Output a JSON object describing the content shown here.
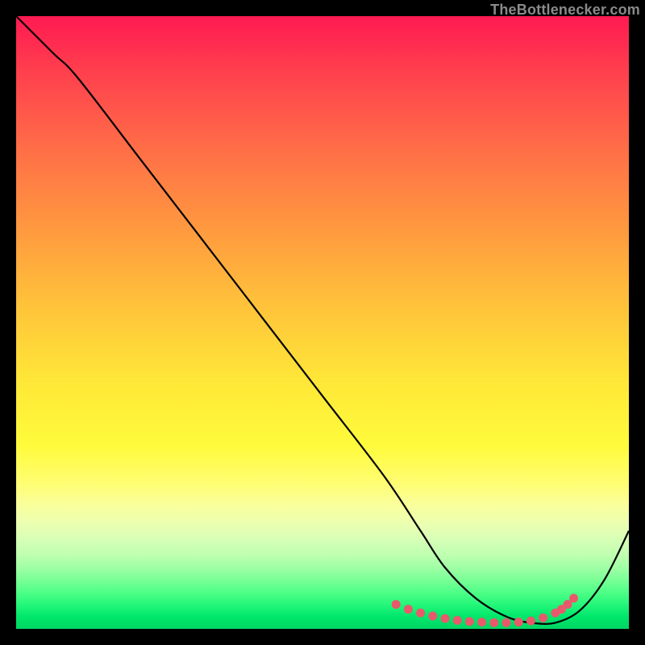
{
  "watermark": "TheBottlenecker.com",
  "chart_data": {
    "type": "line",
    "title": "",
    "xlabel": "",
    "ylabel": "",
    "xlim": [
      0,
      100
    ],
    "ylim": [
      0,
      100
    ],
    "series": [
      {
        "name": "curve",
        "x": [
          0,
          6,
          10,
          20,
          30,
          40,
          50,
          60,
          66,
          70,
          75,
          80,
          84,
          88,
          92,
          96,
          100
        ],
        "y": [
          100,
          94,
          90,
          77,
          64,
          51,
          38,
          25,
          16,
          10,
          5,
          2,
          1,
          1,
          3,
          8,
          16
        ]
      }
    ],
    "markers": {
      "name": "highlight-dots",
      "color": "#e85a6b",
      "x": [
        62,
        64,
        66,
        68,
        70,
        72,
        74,
        76,
        78,
        80,
        82,
        84,
        86,
        88,
        89,
        90,
        91
      ],
      "y": [
        4.0,
        3.2,
        2.6,
        2.1,
        1.7,
        1.4,
        1.2,
        1.1,
        1.0,
        1.0,
        1.1,
        1.3,
        1.8,
        2.6,
        3.2,
        4.0,
        5.0
      ]
    },
    "gradient_stops": [
      {
        "pos": 0,
        "color": "#ff1a52"
      },
      {
        "pos": 50,
        "color": "#ffd93a"
      },
      {
        "pos": 80,
        "color": "#f9ff8a"
      },
      {
        "pos": 100,
        "color": "#00d662"
      }
    ]
  }
}
